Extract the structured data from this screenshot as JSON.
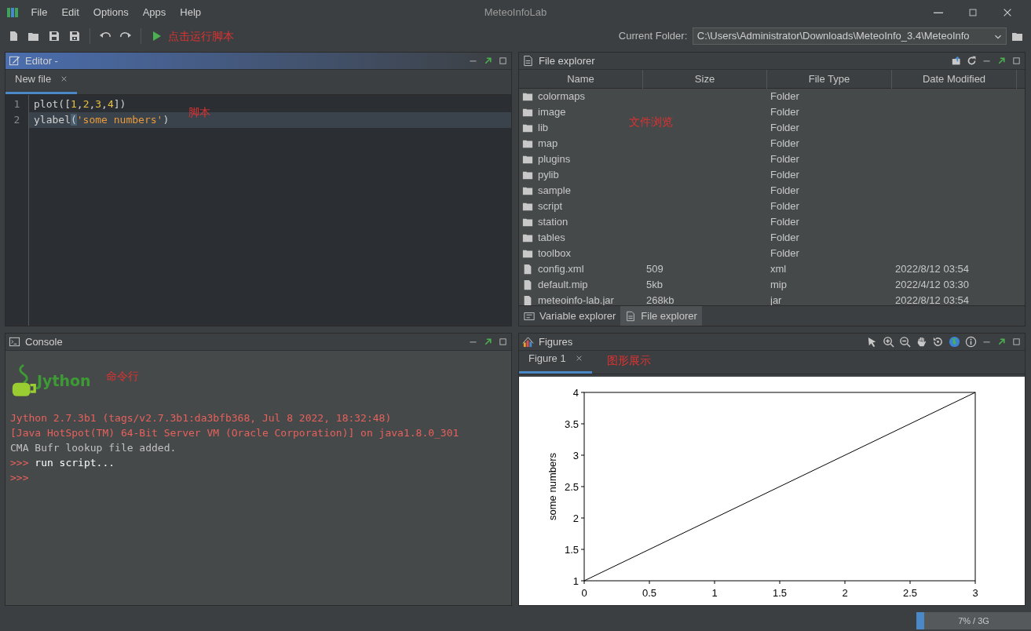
{
  "window": {
    "title": "MeteoInfoLab"
  },
  "menu": [
    "File",
    "Edit",
    "Options",
    "Apps",
    "Help"
  ],
  "toolbar": {
    "annotation": "点击运行脚本",
    "current_folder_label": "Current Folder:",
    "current_folder": "C:\\Users\\Administrator\\Downloads\\MeteoInfo_3.4\\MeteoInfo"
  },
  "editor": {
    "title": "Editor -",
    "active": true,
    "annotation": "脚本",
    "tabs": [
      {
        "label": "New file",
        "selected": true
      }
    ],
    "lines": [
      {
        "number": "1",
        "current": false,
        "tokens": [
          {
            "text": "plot([",
            "kind": "plain"
          },
          {
            "text": "1",
            "kind": "number"
          },
          {
            "text": ",",
            "kind": "plain"
          },
          {
            "text": "2",
            "kind": "number"
          },
          {
            "text": ",",
            "kind": "plain"
          },
          {
            "text": "3",
            "kind": "number"
          },
          {
            "text": ",",
            "kind": "plain"
          },
          {
            "text": "4",
            "kind": "number"
          },
          {
            "text": "])",
            "kind": "plain"
          }
        ]
      },
      {
        "number": "2",
        "current": true,
        "tokens": [
          {
            "text": "ylabel",
            "kind": "plain"
          },
          {
            "text": "(",
            "kind": "bracket"
          },
          {
            "text": "'some numbers'",
            "kind": "string"
          },
          {
            "text": ")",
            "kind": "plain"
          }
        ]
      }
    ]
  },
  "file_explorer": {
    "title": "File explorer",
    "annotation": "文件浏览",
    "columns": [
      "Name",
      "Size",
      "File Type",
      "Date Modified"
    ],
    "rows": [
      {
        "kind": "folder",
        "name": "colormaps",
        "type": "Folder"
      },
      {
        "kind": "folder",
        "name": "image",
        "type": "Folder"
      },
      {
        "kind": "folder",
        "name": "lib",
        "type": "Folder"
      },
      {
        "kind": "folder",
        "name": "map",
        "type": "Folder"
      },
      {
        "kind": "folder",
        "name": "plugins",
        "type": "Folder"
      },
      {
        "kind": "folder",
        "name": "pylib",
        "type": "Folder"
      },
      {
        "kind": "folder",
        "name": "sample",
        "type": "Folder"
      },
      {
        "kind": "folder",
        "name": "script",
        "type": "Folder"
      },
      {
        "kind": "folder",
        "name": "station",
        "type": "Folder"
      },
      {
        "kind": "folder",
        "name": "tables",
        "type": "Folder"
      },
      {
        "kind": "folder",
        "name": "toolbox",
        "type": "Folder"
      },
      {
        "kind": "file",
        "name": "config.xml",
        "size": "509",
        "type": "xml",
        "date": "2022/8/12 03:54"
      },
      {
        "kind": "file",
        "name": "default.mip",
        "size": "5kb",
        "type": "mip",
        "date": "2022/4/12 03:30"
      },
      {
        "kind": "file",
        "name": "meteoinfo-lab.jar",
        "size": "268kb",
        "type": "jar",
        "date": "2022/8/12 03:54"
      }
    ],
    "tabs": [
      {
        "label": "Variable explorer",
        "kind": "variable",
        "selected": false
      },
      {
        "label": "File explorer",
        "kind": "file",
        "selected": true
      }
    ]
  },
  "console": {
    "title": "Console",
    "logo_text": "Jython",
    "annotation": "命令行",
    "lines": [
      {
        "kind": "error",
        "text": "Jython 2.7.3b1 (tags/v2.7.3b1:da3bfb368, Jul 8 2022, 18:32:48)"
      },
      {
        "kind": "error",
        "text": "[Java HotSpot(TM) 64-Bit Server VM (Oracle Corporation)] on java1.8.0_301"
      },
      {
        "kind": "info",
        "text": "CMA Bufr lookup file added."
      },
      {
        "kind": "input",
        "prompt": ">>>",
        "text": "run script..."
      },
      {
        "kind": "input",
        "prompt": ">>>"
      }
    ]
  },
  "figures": {
    "title": "Figures",
    "annotation": "图形展示",
    "tabs": [
      {
        "label": "Figure 1",
        "selected": true
      }
    ],
    "chart_data": {
      "type": "line",
      "ylabel": "some numbers",
      "x": [
        0,
        1,
        2,
        3
      ],
      "values": [
        1,
        2,
        3,
        4
      ],
      "xlim": [
        0,
        3
      ],
      "ylim": [
        1,
        4
      ],
      "xticks": [
        0,
        0.5,
        1,
        1.5,
        2,
        2.5,
        3
      ],
      "yticks": [
        1,
        1.5,
        2,
        2.5,
        3,
        3.5,
        4
      ]
    }
  },
  "status_bar": {
    "memory": {
      "level": 0.07,
      "text": "7% / 3G"
    }
  }
}
